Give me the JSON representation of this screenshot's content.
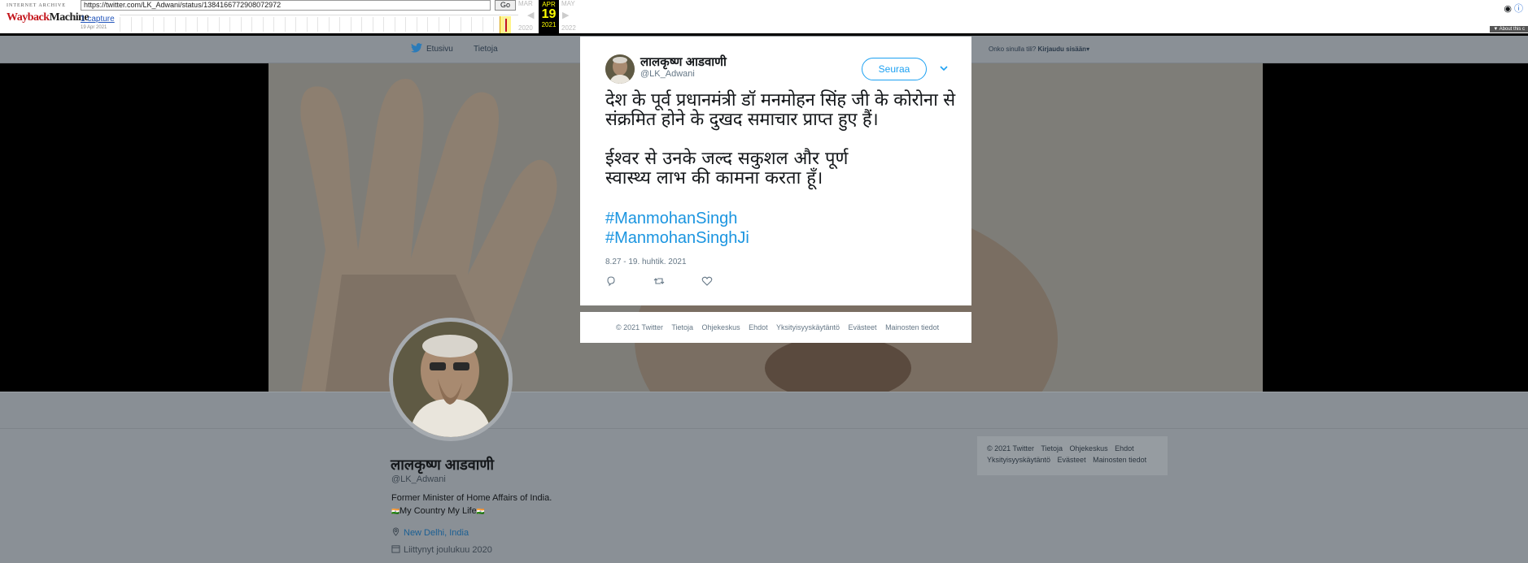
{
  "wayback": {
    "url": "https://twitter.com/LK_Adwani/status/1384166772908072972",
    "go_label": "Go",
    "captures_link": "1 capture",
    "capture_date": "19 Apr 2021",
    "prev_month": "MAR",
    "current_month": "APR",
    "current_day": "19",
    "current_year": "2021",
    "next_month": "MAY",
    "prev_year": "2020",
    "next_year": "2022",
    "about_label": "▼ About this c",
    "logo_top": "INTERNET ARCHIVE",
    "logo_wayback": "Wayback",
    "logo_machine": "Machine"
  },
  "nav": {
    "home": "Etusivu",
    "about": "Tietoja",
    "have_account": "Onko sinulla tili?",
    "login": "Kirjaudu sisään"
  },
  "profile": {
    "name": "लालकृष्ण आडवाणी",
    "handle": "@LK_Adwani",
    "bio": "Former Minister of Home Affairs of India.",
    "bio_img_alt": "🇮🇳",
    "bio_link": "My Country My Life",
    "location": "New Delhi, India",
    "joined": "Liittynyt joulukuu 2020"
  },
  "side_footer": [
    "© 2021 Twitter",
    "Tietoja",
    "Ohjekeskus",
    "Ehdot",
    "Yksityisyyskäytäntö",
    "Evästeet",
    "Mainosten tiedot"
  ],
  "tweet": {
    "name": "लालकृष्ण आडवाणी",
    "handle": "@LK_Adwani",
    "follow_label": "Seuraa",
    "paragraph1": "देश के पूर्व प्रधानमंत्री डॉ मनमोहन सिंह जी के कोरोना से संक्रमित होने के दुखद समाचार प्राप्त हुए हैं।",
    "paragraph2_line1": "ईश्वर से उनके जल्द सकुशल और पूर्ण",
    "paragraph2_line2": "स्वास्थ्य लाभ की कामना करता हूँ।",
    "hashtag1": "#ManmohanSingh",
    "hashtag2": "#ManmohanSinghJi",
    "timestamp": "8.27 - 19. huhtik. 2021"
  },
  "modal_footer": [
    "© 2021 Twitter",
    "Tietoja",
    "Ohjekeskus",
    "Ehdot",
    "Yksityisyyskäytäntö",
    "Evästeet",
    "Mainosten tiedot"
  ],
  "colors": {
    "accent": "#1da1f2",
    "hashtag": "#1b95e0",
    "overlay_bg": "#8a9096"
  }
}
